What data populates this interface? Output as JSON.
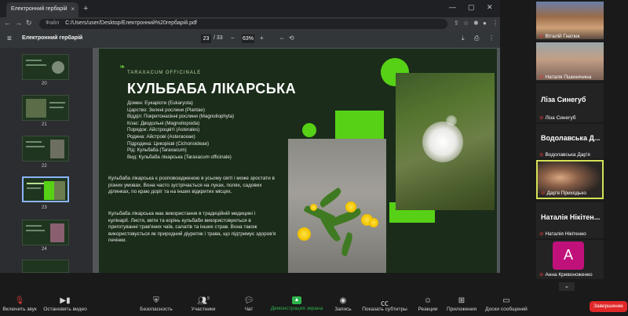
{
  "browser": {
    "tab_title": "Електронний гербарій",
    "url_label": "Файл",
    "url": "C:/Users/user/Desktop/Електронний%20гербарій.pdf"
  },
  "pdf": {
    "title": "Електронний гербарій",
    "page_current": "23",
    "page_total": "/ 33",
    "zoom": "63%"
  },
  "thumbnails": [
    {
      "num": "20"
    },
    {
      "num": "21"
    },
    {
      "num": "22"
    },
    {
      "num": "23",
      "selected": true
    },
    {
      "num": "24"
    }
  ],
  "slide": {
    "latin": "TARAXACUM OFFICINALE",
    "title": "КУЛЬБАБА ЛІКАРСЬКА",
    "taxonomy": [
      "Домен: Еукаріоти (Eukaryota)",
      "Царство: Зелені рослини (Plantae)",
      "Відділ: Покритонасінні рослини (Magnoliophyta)",
      "Клас: Дводольні (Magnoliopsida)",
      "Порядок: Айстроцвіті (Asterales)",
      "Родина: Айстрові (Asteraceae)",
      "Підродина: Цикорієві (Cichorioideae)",
      "Рід: Кульбаба (Taraxacum)",
      "Вид: Кульбаба лікарська (Taraxacum officinale)"
    ],
    "para1": "Кульбаба лікарська є розповсюдженою в усьому світі і може зростати в різних умовах. Вона часто зустрічається на луках, полях, садових ділянках, по краю доріг та на інших відкритих місцях.",
    "para2": "Кульбаба лікарська має використання в традиційній медицині і кулінарії. Листя, квіти та корінь кульбаби використовуються в приготуванні трав'яних чаїв, салатів та інших страв. Вона також використовується як природний діуретик і трава, що підтримує здоров'я печінки."
  },
  "participants": [
    {
      "name": "Віталій Гнатюк",
      "video": true
    },
    {
      "name": "Наталя Пшеничина",
      "video": true
    },
    {
      "name": "Ліза Синегуб",
      "display": "Ліза Синегуб",
      "video": false
    },
    {
      "name": "Водолавська Дар'я",
      "display": "Водолавська  Д...",
      "video": false
    },
    {
      "name": "Дар'я Приходько",
      "video": true
    },
    {
      "name": "Наталія Нікітенко",
      "display": "Наталія  Нікітен...",
      "video": false
    },
    {
      "name": "Анна Кривоноженко",
      "avatar": "A",
      "video": false
    }
  ],
  "zoom_toolbar": {
    "mute": "Включить звук",
    "video": "Остановить видео",
    "security": "Безопасность",
    "participants": "Участники",
    "participants_count": "9",
    "chat": "Чат",
    "share": "Демонстрация экрана",
    "record": "Запись",
    "subtitles": "Показать субтитры",
    "reactions": "Реакции",
    "apps": "Приложения",
    "whiteboard": "Доски сообщений",
    "end": "Завершение"
  },
  "colors": {
    "slide_bg": "#1b2d1a",
    "accent_green": "#56d116",
    "end_red": "#e02828",
    "share_green": "#2eb34b"
  }
}
